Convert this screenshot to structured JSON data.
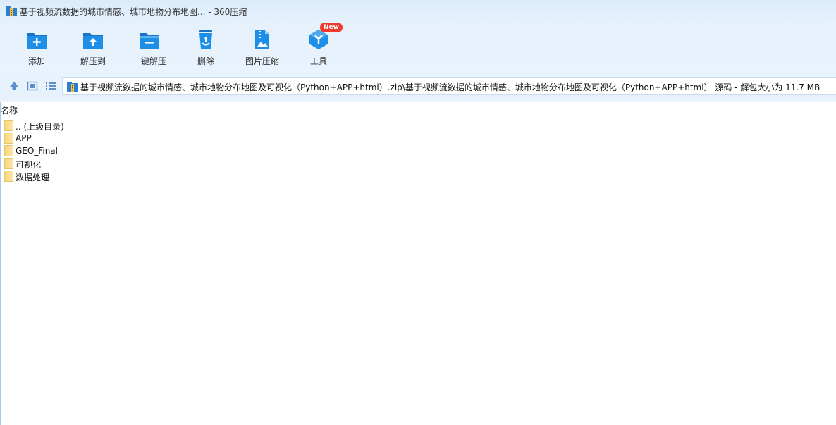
{
  "window": {
    "title": "基于视频流数据的城市情感、城市地物分布地图... - 360压缩"
  },
  "toolbar": {
    "buttons": [
      {
        "label": "添加",
        "icon": "add-folder-icon"
      },
      {
        "label": "解压到",
        "icon": "extract-to-folder-icon"
      },
      {
        "label": "一键解压",
        "icon": "one-click-extract-icon"
      },
      {
        "label": "删除",
        "icon": "recycle-bin-icon"
      },
      {
        "label": "图片压缩",
        "icon": "image-compress-icon"
      },
      {
        "label": "工具",
        "icon": "tools-cube-icon",
        "badge": "New"
      }
    ]
  },
  "navbar": {
    "path": "基于视频流数据的城市情感、城市地物分布地图及可视化（Python+APP+html）.zip\\基于视频流数据的城市情感、城市地物分布地图及可视化（Python+APP+html） 源码 - 解包大小为 11.7 MB"
  },
  "filelist": {
    "column_name": "名称",
    "items": [
      {
        "name": ".. (上级目录)"
      },
      {
        "name": "APP"
      },
      {
        "name": "GEO_Final"
      },
      {
        "name": "可视化"
      },
      {
        "name": "数据处理"
      }
    ]
  },
  "colors": {
    "accent": "#1e8fe6",
    "accent_dark": "#1a73c9",
    "badge": "#f03a2e",
    "folder": "#f7d77e"
  }
}
